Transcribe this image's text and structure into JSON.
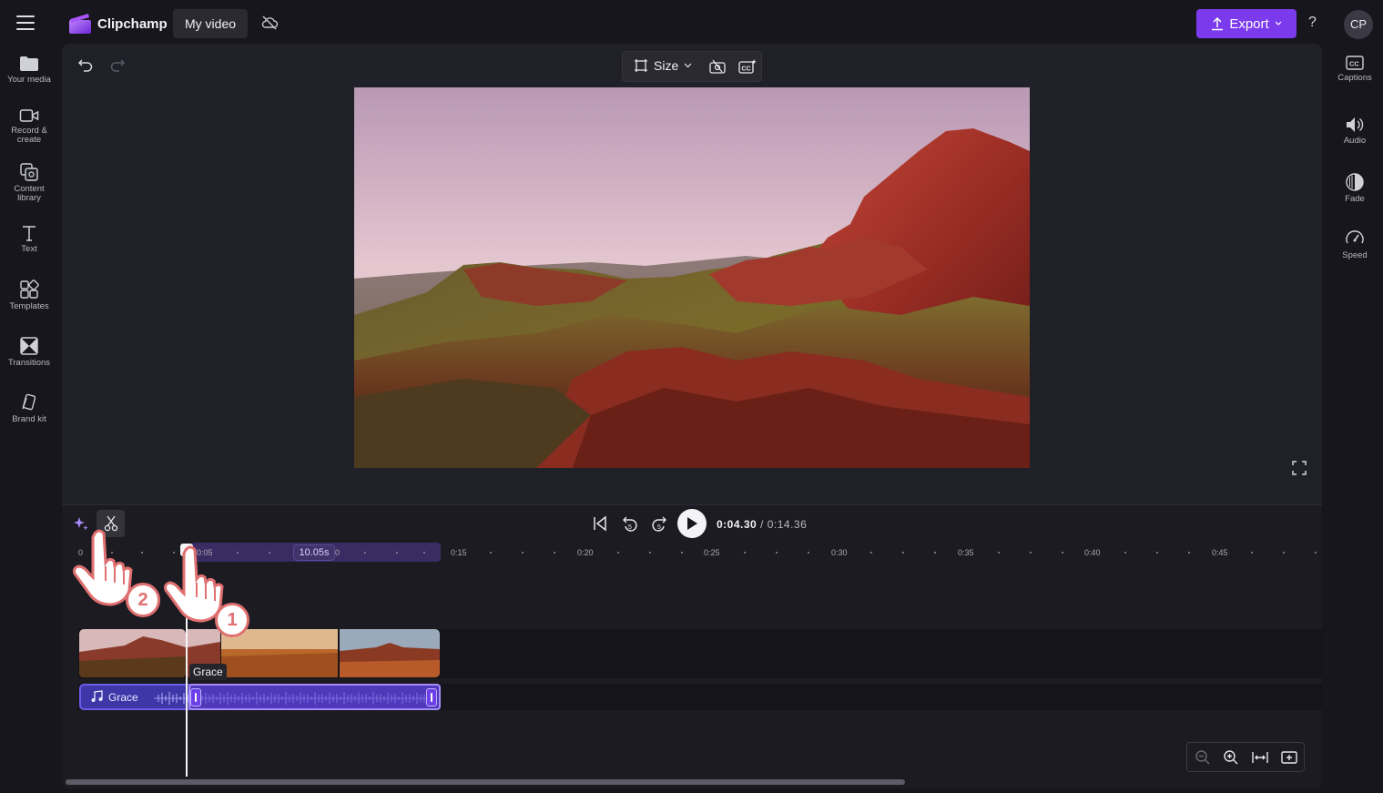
{
  "app": {
    "brand": "Clipchamp",
    "project_name": "My video",
    "accent": "#7c3aed"
  },
  "header": {
    "export_label": "Export",
    "help_label": "?",
    "avatar_initials": "CP"
  },
  "left_nav": [
    {
      "label": "Your media",
      "icon": "folder-icon"
    },
    {
      "label": "Record &",
      "label2": "create",
      "icon": "camera-icon"
    },
    {
      "label": "Content",
      "label2": "library",
      "icon": "content-library-icon"
    },
    {
      "label": "Text",
      "icon": "text-icon"
    },
    {
      "label": "Templates",
      "icon": "templates-icon"
    },
    {
      "label": "Transitions",
      "icon": "transitions-icon"
    },
    {
      "label": "Brand kit",
      "icon": "brand-kit-icon"
    }
  ],
  "right_nav": [
    {
      "label": "Captions",
      "icon": "captions-icon"
    },
    {
      "label": "Audio",
      "icon": "audio-icon"
    },
    {
      "label": "Fade",
      "icon": "fade-icon"
    },
    {
      "label": "Speed",
      "icon": "speed-icon"
    }
  ],
  "preview_toolbar": {
    "size_label": "Size"
  },
  "playback": {
    "current_time": "0:04.30",
    "total_time": "/ 0:14.36"
  },
  "timeline": {
    "ticks": [
      "0",
      "0:05",
      "0",
      "0:15",
      "0:20",
      "0:25",
      "0:30",
      "0:35",
      "0:40",
      "0:45"
    ],
    "selection_duration": "10.05s",
    "video_clip_label": "Grace",
    "audio_clip_label": "Grace"
  },
  "annotations": {
    "step_1": "1",
    "step_2": "2"
  }
}
